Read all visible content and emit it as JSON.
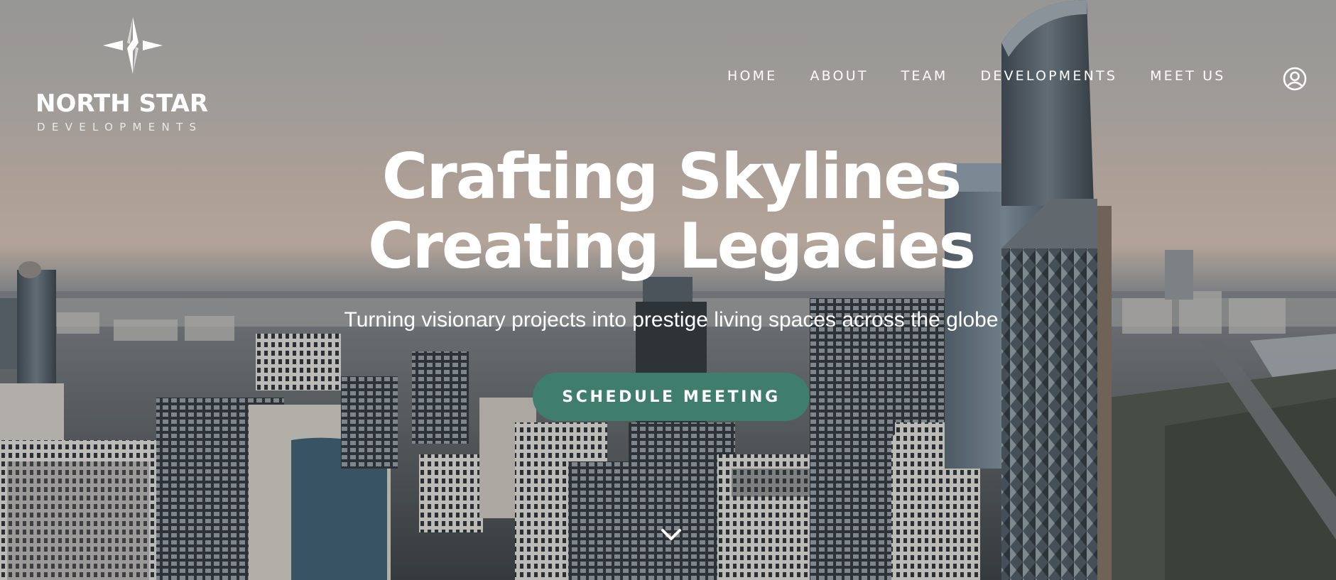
{
  "brand": {
    "name": "NORTH STAR",
    "tagline": "DEVELOPMENTS",
    "logo_icon": "compass-star-icon"
  },
  "nav": {
    "items": [
      {
        "label": "HOME"
      },
      {
        "label": "ABOUT"
      },
      {
        "label": "TEAM"
      },
      {
        "label": "DEVELOPMENTS"
      },
      {
        "label": "MEET US"
      }
    ],
    "account_icon": "user-circle-icon"
  },
  "hero": {
    "headline_line1": "Crafting Skylines",
    "headline_line2": "Creating Legacies",
    "subheadline": "Turning visionary projects into prestige living spaces across the globe",
    "cta_label": "SCHEDULE MEETING",
    "scroll_icon": "chevron-down-icon",
    "background": "city-skyline-photo"
  },
  "colors": {
    "accent": "#3f7d6d",
    "text": "#ffffff"
  }
}
